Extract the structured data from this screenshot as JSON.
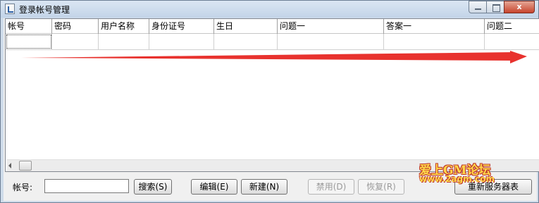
{
  "window": {
    "title": "登录帐号管理",
    "close_glyph": "x"
  },
  "grid": {
    "columns": [
      "帐号",
      "密码",
      "用户名称",
      "身份证号",
      "生日",
      "问题一",
      "答案一",
      "问题二"
    ]
  },
  "footer": {
    "account_label": "帐号:",
    "account_value": "",
    "search_label": "搜索(S)",
    "edit_label": "编辑(E)",
    "new_label": "新建(N)",
    "disable_label": "禁用(D)",
    "restore_label": "恢复(R)",
    "refresh_label": "重新服务器表"
  },
  "watermark": {
    "line1": "爱上GM论坛",
    "line2": "www.2agm.com"
  },
  "colors": {
    "arrow": "#e8322e",
    "close_button": "#c7442d"
  },
  "icons": {
    "app": "app-icon",
    "minimize": "minimize-icon",
    "maximize": "maximize-icon",
    "close": "close-icon"
  }
}
